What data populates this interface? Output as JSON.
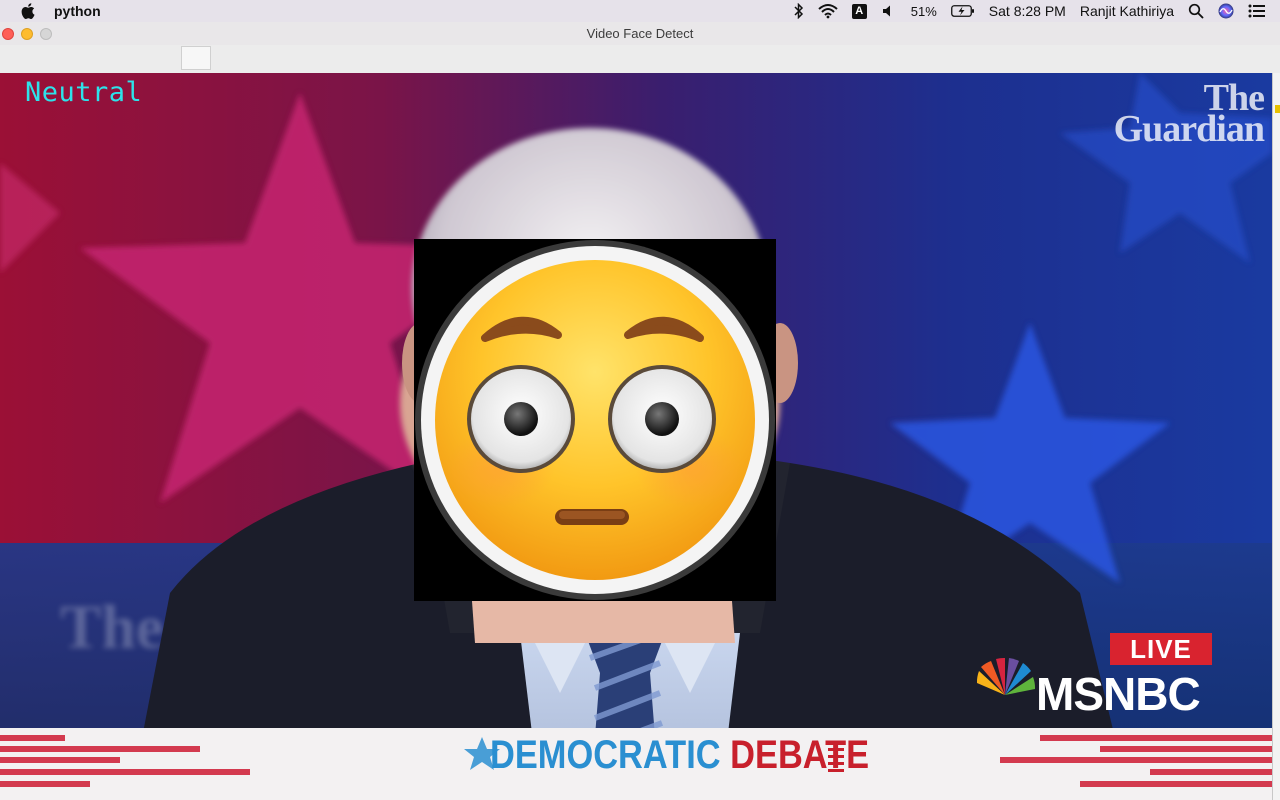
{
  "menubar": {
    "apple_icon": "apple-icon",
    "app_name": "python",
    "battery_percent": "51%",
    "clock": "Sat 8:28 PM",
    "user": "Ranjit Kathiriya",
    "input_source": "A",
    "icons": [
      "bluetooth-icon",
      "wifi-icon",
      "input-source-icon",
      "volume-icon",
      "battery-icon",
      "spotlight-icon",
      "siri-icon",
      "control-center-icon"
    ]
  },
  "window": {
    "title": "Video Face Detect"
  },
  "video": {
    "emotion_label": "Neutral",
    "emotion_label_color": "#2de3ea",
    "overlay_emoji": "flushed-face-emoji",
    "watermark_lines": [
      "The",
      "Guardian"
    ],
    "live_badge": "LIVE",
    "network_logo": "MSNBC",
    "banner_word1": "DEMOCRATIC",
    "banner_word2": "DEBATE",
    "colors": {
      "live_red": "#d9232f",
      "banner_blue": "#2a8fd1",
      "banner_red": "#c8202c"
    }
  }
}
